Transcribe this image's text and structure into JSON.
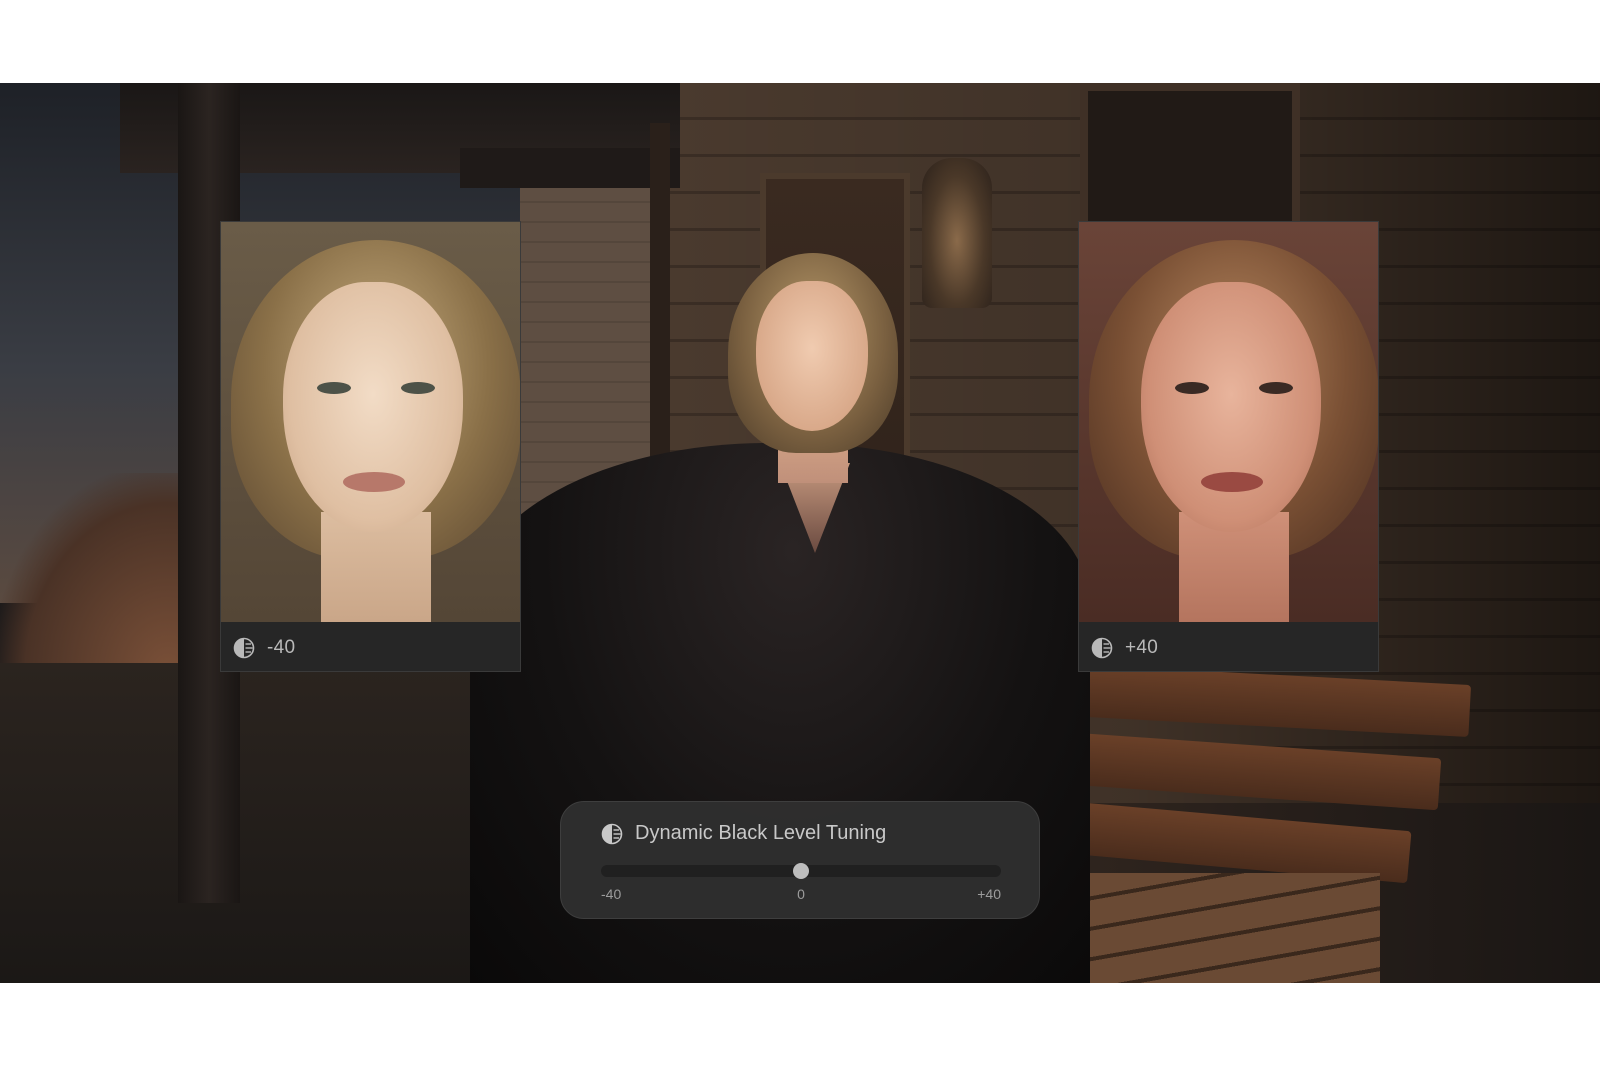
{
  "preview_cards": [
    {
      "value_label": "-40",
      "icon": "contrast-icon"
    },
    {
      "value_label": "+40",
      "icon": "contrast-icon"
    }
  ],
  "control_panel": {
    "title": "Dynamic Black Level Tuning",
    "icon": "contrast-icon",
    "slider": {
      "min_label": "-40",
      "mid_label": "0",
      "max_label": "+40",
      "min": -40,
      "max": 40,
      "value": 0
    }
  }
}
